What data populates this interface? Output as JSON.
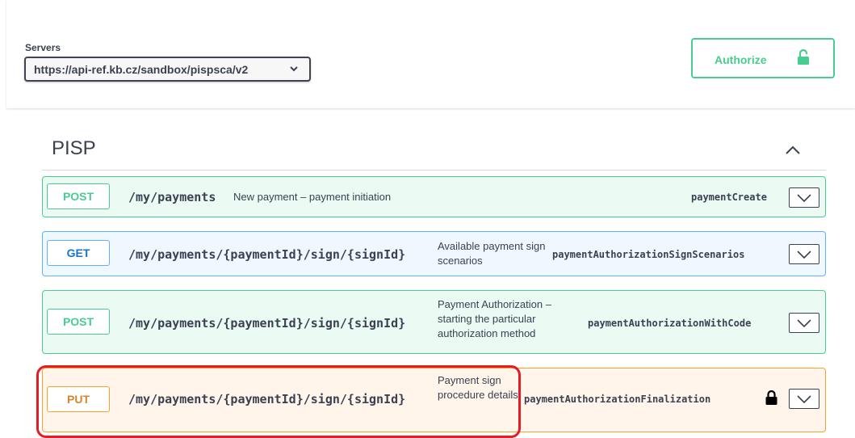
{
  "servers": {
    "label": "Servers",
    "selected": "https://api-ref.kb.cz/sandbox/pispsca/v2"
  },
  "authorize": {
    "label": "Authorize",
    "icon": "unlock-icon"
  },
  "tag": {
    "name": "PISP",
    "toggle_icon": "chevron-up-icon"
  },
  "operations": [
    {
      "method": "POST",
      "path": "/my/payments",
      "summary": "New payment – payment initiation",
      "operation_id": "paymentCreate"
    },
    {
      "method": "GET",
      "path": "/my/payments/{paymentId}/sign/{signId}",
      "summary": "Available payment sign scenarios",
      "operation_id": "paymentAuthorizationSignScenarios"
    },
    {
      "method": "POST",
      "path": "/my/payments/{paymentId}/sign/{signId}",
      "summary": "Payment Authorization – starting the particular authorization method",
      "operation_id": "paymentAuthorizationWithCode"
    },
    {
      "method": "PUT",
      "path": "/my/payments/{paymentId}/sign/{signId}",
      "summary": "Payment sign procedure details",
      "operation_id": "paymentAuthorizationFinalization",
      "lock_icon": "lock-icon"
    }
  ],
  "colors": {
    "post": "#49cc90",
    "get": "#61affe",
    "put": "#fca130",
    "highlight": "#e11d2a"
  }
}
